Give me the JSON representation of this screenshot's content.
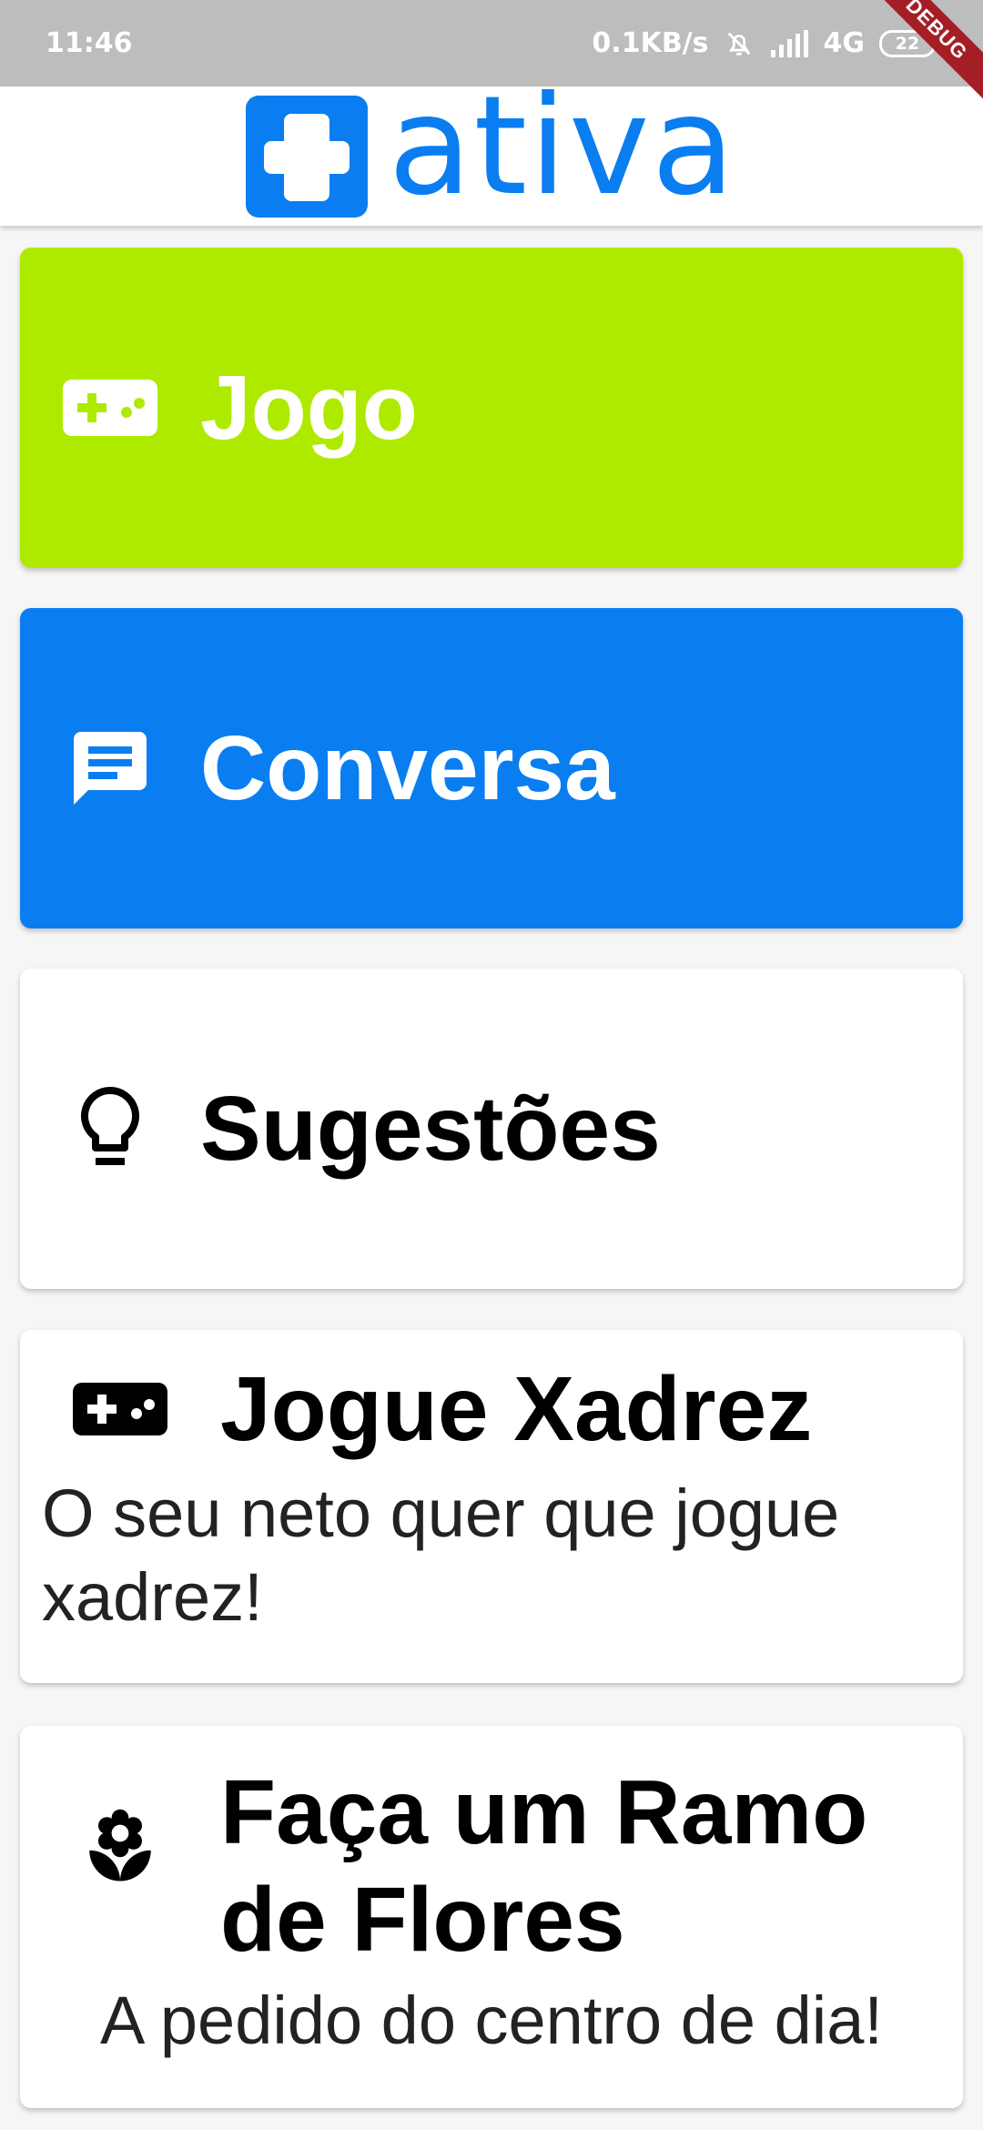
{
  "status_bar": {
    "time": "11:46",
    "net_speed": "0.1KB/s",
    "network": "4G",
    "battery": "22",
    "icons": [
      "alarm-off-icon",
      "signal-icon",
      "battery-icon"
    ]
  },
  "debug_banner": "DEBUG",
  "header": {
    "logo_text": "ativa",
    "brand_color": "#0a7ef0"
  },
  "menu": {
    "jogo": {
      "label": "Jogo",
      "icon": "gamepad-icon",
      "color": "#aeea00"
    },
    "conversa": {
      "label": "Conversa",
      "icon": "chat-icon",
      "color": "#0a7ef0"
    },
    "sugestoes": {
      "label": "Sugestões",
      "icon": "lightbulb-icon",
      "color": "#ffffff"
    }
  },
  "suggestions": [
    {
      "title": "Jogue Xadrez",
      "description": "O seu neto quer que jogue xadrez!",
      "icon": "gamepad-icon"
    },
    {
      "title": "Faça um Ramo de Flores",
      "description": "A pedido do centro de dia!",
      "icon": "flower-icon"
    }
  ]
}
